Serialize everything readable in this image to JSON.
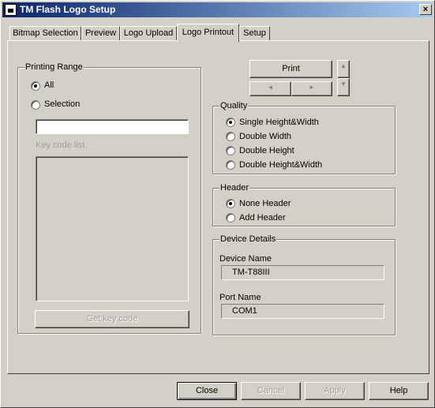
{
  "window": {
    "title": "TM Flash Logo Setup",
    "close_glyph": "×"
  },
  "tabs": [
    {
      "label": "Bitmap Selection"
    },
    {
      "label": "Preview"
    },
    {
      "label": "Logo Upload"
    },
    {
      "label": "Logo Printout"
    },
    {
      "label": "Setup"
    }
  ],
  "printing_range": {
    "title": "Printing Range",
    "all_label": "All",
    "selection_label": "Selection",
    "selected": "All",
    "selection_value": "",
    "keycode_list_label": "Key code list",
    "get_key_code_label": "Get key code"
  },
  "print": {
    "label": "Print",
    "up_glyph": "▲",
    "down_glyph": "▼",
    "left_glyph": "◄",
    "right_glyph": "►"
  },
  "quality": {
    "title": "Quality",
    "options": [
      {
        "label": "Single Height&Width"
      },
      {
        "label": "Double Width"
      },
      {
        "label": "Double Height"
      },
      {
        "label": "Double Height&Width"
      }
    ],
    "selected": "Single Height&Width"
  },
  "header": {
    "title": "Header",
    "options": [
      {
        "label": "None Header"
      },
      {
        "label": "Add Header"
      }
    ],
    "selected": "None Header"
  },
  "device": {
    "title": "Device Details",
    "device_name_label": "Device Name",
    "device_name": "TM-T88III",
    "port_name_label": "Port Name",
    "port_name": "COM1"
  },
  "footer": {
    "close": "Close",
    "cancel": "Cancel",
    "apply": "Apply",
    "help": "Help"
  }
}
